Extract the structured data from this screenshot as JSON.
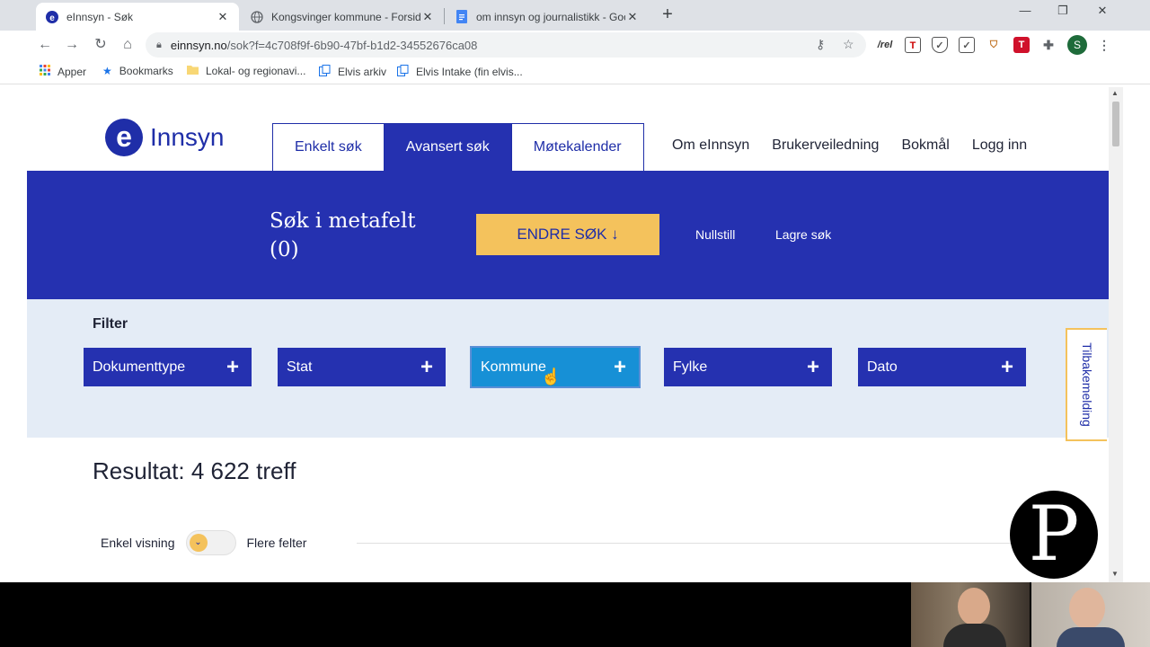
{
  "browser": {
    "tabs": [
      {
        "title": "eInnsyn - Søk",
        "icon": "einnsyn-favicon",
        "active": true
      },
      {
        "title": "Kongsvinger kommune - Forside",
        "icon": "globe-icon",
        "active": false
      },
      {
        "title": "om innsyn og journalistikk - Goo",
        "icon": "docs-icon",
        "active": false
      }
    ],
    "url_domain": "einnsyn.no",
    "url_path": "/sok?f=4c708f9f-6b90-47bf-b1d2-34552676ca08",
    "profile_initial": "S",
    "bookmarks": [
      {
        "label": "Apper",
        "icon": "apps-grid-icon"
      },
      {
        "label": "Bookmarks",
        "icon": "star-icon"
      },
      {
        "label": "Lokal- og regionavi...",
        "icon": "folder-icon"
      },
      {
        "label": "Elvis arkiv",
        "icon": "bookmark-page-icon"
      },
      {
        "label": "Elvis Intake (fin elvis...",
        "icon": "bookmark-page-icon"
      }
    ]
  },
  "site": {
    "logo_letter": "e",
    "logo_word": "Innsyn",
    "nav_tabs": [
      "Enkelt søk",
      "Avansert søk",
      "Møtekalender"
    ],
    "active_tab": "Avansert søk",
    "top_links": [
      "Om eInnsyn",
      "Brukerveiledning",
      "Bokmål",
      "Logg inn"
    ],
    "search_heading_line1": "Søk i metafelt",
    "search_heading_line2": "(0)",
    "endre_button": "ENDRE SØK ↓",
    "reset_link": "Nullstill",
    "save_link": "Lagre søk",
    "filter_label": "Filter",
    "filters": [
      "Dokumenttype",
      "Stat",
      "Kommune",
      "Fylke",
      "Dato"
    ],
    "hovered_filter": "Kommune",
    "feedback_tab": "Tilbakemelding",
    "result_text": "Resultat: 4 622 treff",
    "toggle_left": "Enkel visning",
    "toggle_right": "Flere felter",
    "corner_logo_letter": "P"
  },
  "colors": {
    "brand_blue": "#2531b0",
    "accent_yellow": "#f4c25c",
    "filter_bg": "#e4ecf6",
    "hover_blue": "#1790d6"
  }
}
